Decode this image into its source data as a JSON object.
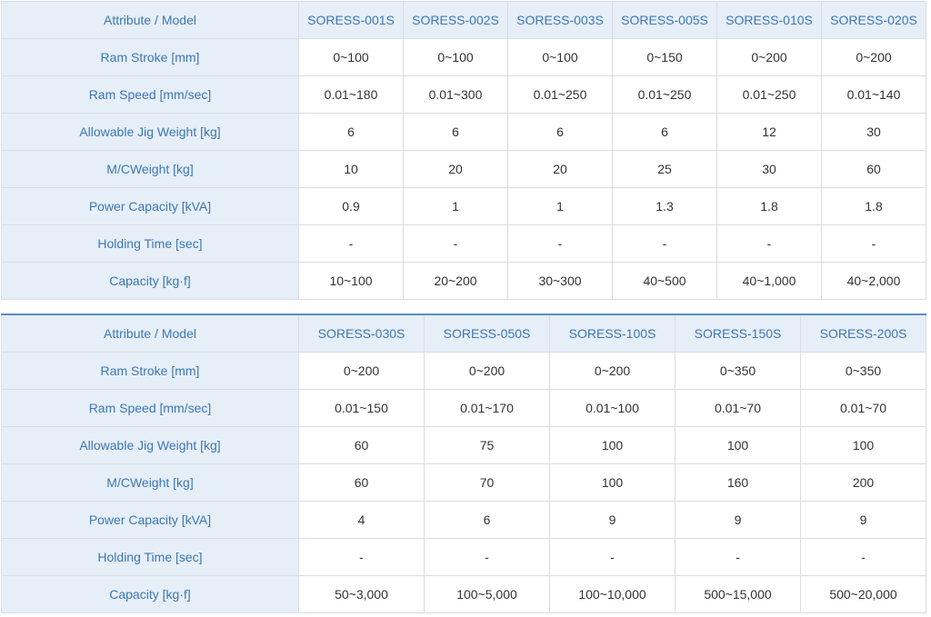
{
  "tables": [
    {
      "header_label": "Attribute / Model",
      "models": [
        "SORESS-001S",
        "SORESS-002S",
        "SORESS-003S",
        "SORESS-005S",
        "SORESS-010S",
        "SORESS-020S"
      ],
      "rows": [
        {
          "label": "Ram Stroke [mm]",
          "values": [
            "0~100",
            "0~100",
            "0~100",
            "0~150",
            "0~200",
            "0~200"
          ]
        },
        {
          "label": "Ram Speed [mm/sec]",
          "values": [
            "0.01~180",
            "0.01~300",
            "0.01~250",
            "0.01~250",
            "0.01~250",
            "0.01~140"
          ]
        },
        {
          "label": "Allowable Jig Weight [kg]",
          "values": [
            "6",
            "6",
            "6",
            "6",
            "12",
            "30"
          ]
        },
        {
          "label": "M/CWeight [kg]",
          "values": [
            "10",
            "20",
            "20",
            "25",
            "30",
            "60"
          ]
        },
        {
          "label": "Power Capacity [kVA]",
          "values": [
            "0.9",
            "1",
            "1",
            "1.3",
            "1.8",
            "1.8"
          ]
        },
        {
          "label": "Holding Time [sec]",
          "values": [
            "-",
            "-",
            "-",
            "-",
            "-",
            "-"
          ]
        },
        {
          "label": "Capacity [kg·f]",
          "values": [
            "10~100",
            "20~200",
            "30~300",
            "40~500",
            "40~1,000",
            "40~2,000"
          ]
        }
      ]
    },
    {
      "header_label": "Attribute / Model",
      "models": [
        "SORESS-030S",
        "SORESS-050S",
        "SORESS-100S",
        "SORESS-150S",
        "SORESS-200S"
      ],
      "rows": [
        {
          "label": "Ram Stroke [mm]",
          "values": [
            "0~200",
            "0~200",
            "0~200",
            "0~350",
            "0~350"
          ]
        },
        {
          "label": "Ram Speed [mm/sec]",
          "values": [
            "0.01~150",
            "0.01~170",
            "0.01~100",
            "0.01~70",
            "0.01~70"
          ]
        },
        {
          "label": "Allowable Jig Weight [kg]",
          "values": [
            "60",
            "75",
            "100",
            "100",
            "100"
          ]
        },
        {
          "label": "M/CWeight [kg]",
          "values": [
            "60",
            "70",
            "100",
            "160",
            "200"
          ]
        },
        {
          "label": "Power Capacity [kVA]",
          "values": [
            "4",
            "6",
            "9",
            "9",
            "9"
          ]
        },
        {
          "label": "Holding Time [sec]",
          "values": [
            "-",
            "-",
            "-",
            "-",
            "-"
          ]
        },
        {
          "label": "Capacity [kg·f]",
          "values": [
            "50~3,000",
            "100~5,000",
            "100~10,000",
            "500~15,000",
            "500~20,000"
          ]
        }
      ]
    }
  ],
  "colors": {
    "header_bg": "#e6eef8",
    "header_text": "#3c78b4",
    "accent_border": "#5a8fc4",
    "value_text": "#333333"
  }
}
